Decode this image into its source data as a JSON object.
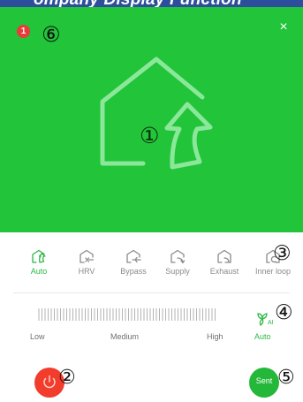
{
  "header": {
    "partial_text": "ompany Display Function"
  },
  "panel": {
    "badge_count": "1",
    "close_glyph": "×",
    "background_color": "#22c43a",
    "main_icon": "house-with-curved-arrow-icon"
  },
  "callouts": {
    "c1": "①",
    "c2": "②",
    "c3": "③",
    "c4": "④",
    "c5": "⑤",
    "c6": "⑥"
  },
  "modes": [
    {
      "label": "Auto",
      "icon": "auto-mode-icon",
      "active": true
    },
    {
      "label": "HRV",
      "icon": "hrv-mode-icon",
      "active": false
    },
    {
      "label": "Bypass",
      "icon": "bypass-mode-icon",
      "active": false
    },
    {
      "label": "Supply",
      "icon": "supply-mode-icon",
      "active": false
    },
    {
      "label": "Exhaust",
      "icon": "exhaust-mode-icon",
      "active": false
    },
    {
      "label": "Inner loop",
      "icon": "inner-loop-mode-icon",
      "active": false
    }
  ],
  "fan": {
    "labels": {
      "low": "Low",
      "medium": "Medium",
      "high": "High"
    },
    "auto_label": "Auto",
    "icon": "fan-ai-icon"
  },
  "buttons": {
    "power_icon": "power-icon",
    "send_label": "Sent"
  },
  "colors": {
    "accent_green": "#2db845",
    "badge_red": "#ea3a3a",
    "power_red": "#f23c2c",
    "header_blue": "#2c4e9c"
  }
}
